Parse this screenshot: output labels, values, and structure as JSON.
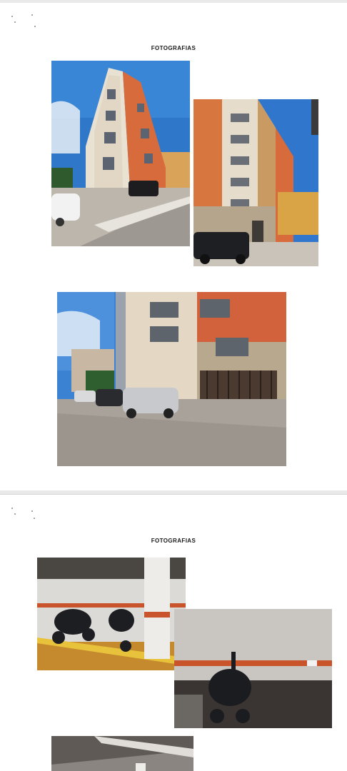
{
  "pages": [
    {
      "heading": "FOTOGRAFIAS"
    },
    {
      "heading": "FOTOGRAFIAS"
    }
  ]
}
